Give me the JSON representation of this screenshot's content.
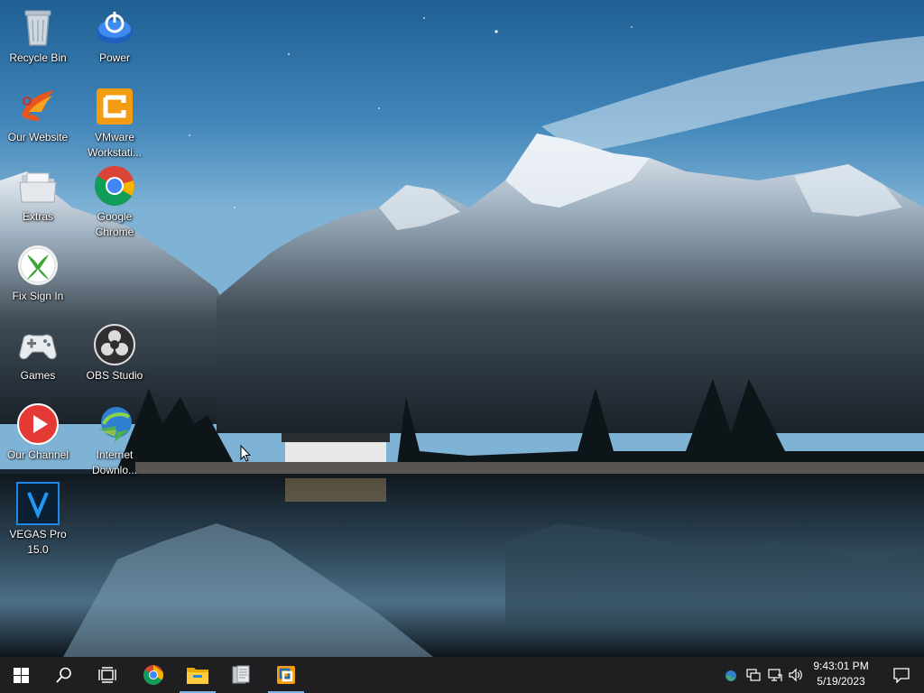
{
  "desktop": {
    "icons": [
      {
        "label": "Recycle Bin",
        "icon": "recycle-bin-icon"
      },
      {
        "label": "Power",
        "icon": "power-icon"
      },
      {
        "label": "Our Website",
        "icon": "phoenix-logo-icon"
      },
      {
        "label": "VMware\nWorkstati...",
        "icon": "vmware-icon"
      },
      {
        "label": "Extras",
        "icon": "folder-icon"
      },
      {
        "label": "Google\nChrome",
        "icon": "chrome-icon"
      },
      {
        "label": "Fix Sign In",
        "icon": "xbox-icon"
      },
      {
        "label": "Games",
        "icon": "gamepad-icon"
      },
      {
        "label": "OBS Studio",
        "icon": "obs-icon"
      },
      {
        "label": "Our Channel",
        "icon": "play-button-icon"
      },
      {
        "label": "Internet\nDownlo...",
        "icon": "internet-download-manager-icon"
      },
      {
        "label": "VEGAS Pro\n15.0",
        "icon": "vegas-pro-icon"
      }
    ]
  },
  "taskbar": {
    "buttons": [
      "start-icon",
      "search-icon",
      "task-view-icon",
      "chrome-icon",
      "file-explorer-icon",
      "document-icon",
      "vmware-icon"
    ],
    "tray": [
      "network-shield-icon",
      "display-icon",
      "ethernet-icon",
      "volume-icon"
    ],
    "clock": {
      "time": "9:43:01 PM",
      "date": "5/19/2023"
    },
    "notification_icon": "notification-icon"
  },
  "colors": {
    "taskbar_bg": "#1f1f21",
    "accent": "#7ab3e8"
  }
}
